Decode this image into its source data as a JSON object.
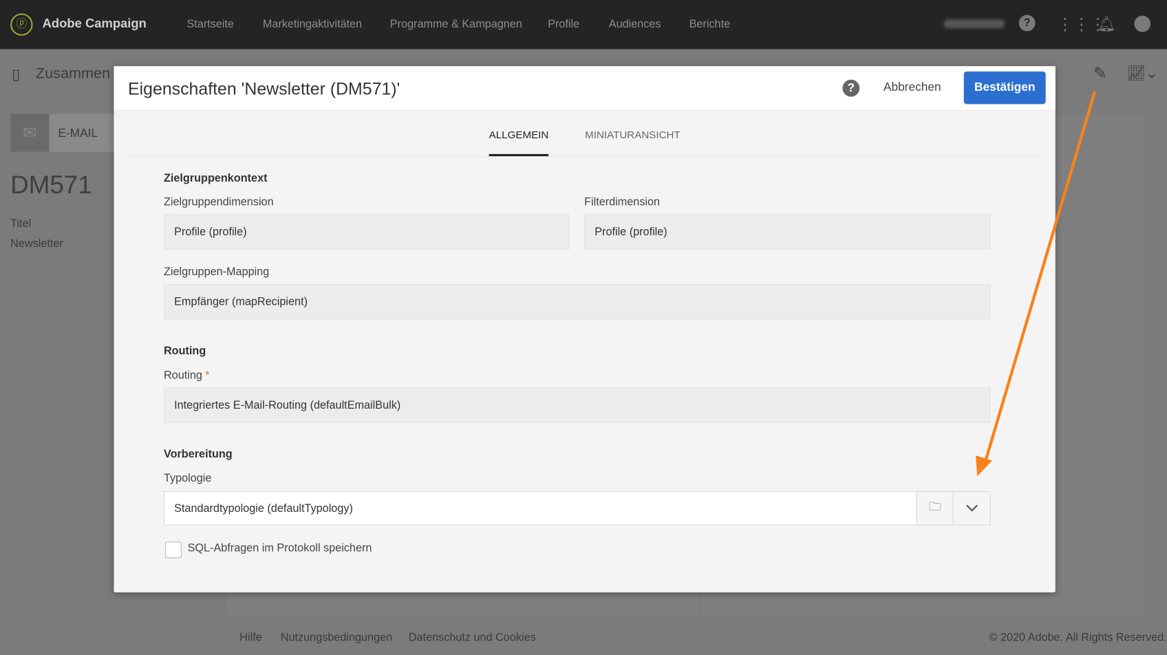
{
  "topbar": {
    "brand": "Adobe Campaign",
    "nav": [
      "Startseite",
      "Marketingaktivitäten",
      "Programme & Kampagnen",
      "Profile",
      "Audiences",
      "Berichte"
    ]
  },
  "background": {
    "breadcrumb": "Zusammen",
    "channel": "E-MAIL",
    "label": "DM571",
    "title_label": "Titel",
    "title_value": "Newsletter"
  },
  "modal": {
    "title": "Eigenschaften 'Newsletter (DM571)'",
    "help": "?",
    "cancel": "Abbrechen",
    "confirm": "Bestätigen",
    "tabs": [
      "ALLGEMEIN",
      "MINIATURANSICHT"
    ],
    "sections": {
      "target": "Zielgruppenkontext",
      "target_dim_label": "Zielgruppendimension",
      "target_dim_value": "Profile (profile)",
      "filter_dim_label": "Filterdimension",
      "filter_dim_value": "Profile (profile)",
      "mapping_label": "Zielgruppen-Mapping",
      "mapping_value": "Empfänger (mapRecipient)",
      "routing": "Routing",
      "routing_label": "Routing",
      "required": "*",
      "routing_value": "Integriertes E-Mail-Routing (defaultEmailBulk)",
      "prep": "Vorbereitung",
      "typology_label": "Typologie",
      "typology_value": "Standardtypologie (defaultTypology)",
      "sql_label": "SQL-Abfragen im Protokoll speichern"
    }
  },
  "footer": {
    "links": [
      "Hilfe",
      "Nutzungsbedingungen",
      "Datenschutz und Cookies"
    ],
    "copyright": "© 2020 Adobe. All Rights Reserved."
  },
  "colors": {
    "accent": "#2d6fd0",
    "arrow": "#f7821b"
  }
}
